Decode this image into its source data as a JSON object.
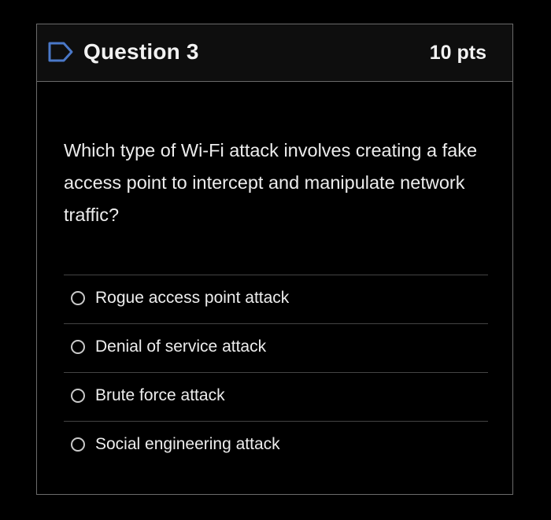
{
  "question": {
    "title": "Question 3",
    "points": "10 pts",
    "icon": "flag-outline-icon",
    "text": "Which type of Wi-Fi attack involves creating a fake access point to intercept and manipulate network traffic?"
  },
  "answers": [
    {
      "label": "Rogue access point attack",
      "selected": false
    },
    {
      "label": "Denial of service attack",
      "selected": false
    },
    {
      "label": "Brute force attack",
      "selected": false
    },
    {
      "label": "Social engineering attack",
      "selected": false
    }
  ],
  "colors": {
    "background": "#000000",
    "icon_accent": "#4a78c8",
    "text": "#ededed",
    "border": "#6b6b6b"
  }
}
